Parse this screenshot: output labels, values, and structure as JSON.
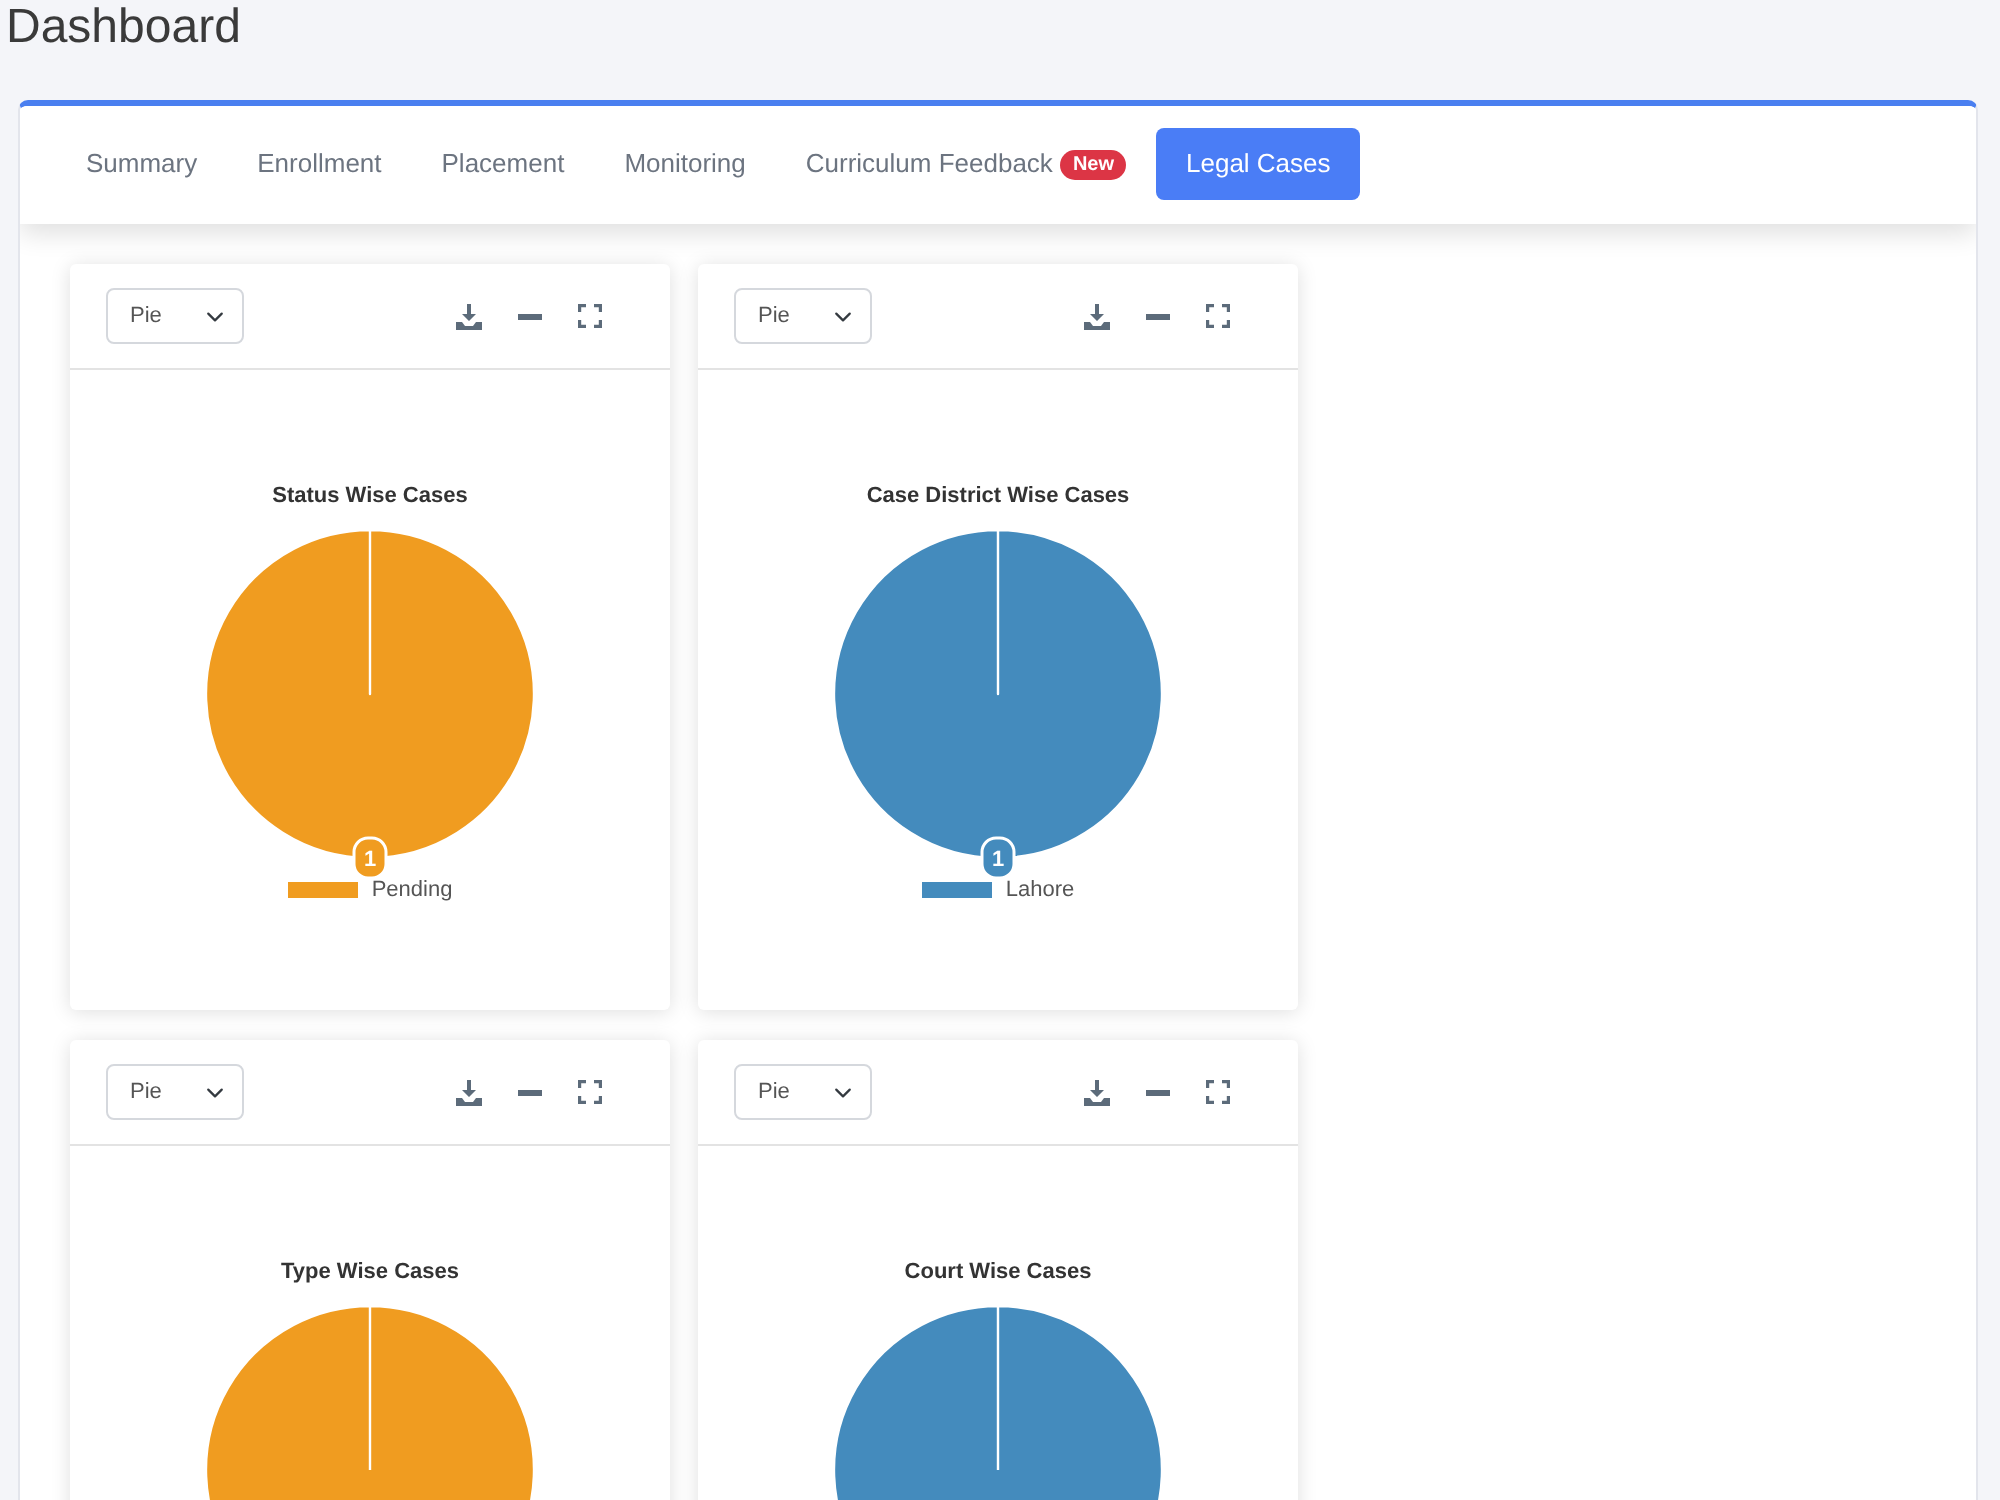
{
  "page": {
    "title": "Dashboard"
  },
  "tabs": [
    {
      "label": "Summary",
      "selected": false
    },
    {
      "label": "Enrollment",
      "selected": false
    },
    {
      "label": "Placement",
      "selected": false
    },
    {
      "label": "Monitoring",
      "selected": false
    },
    {
      "label": "Curriculum Feedback",
      "badge": "New",
      "selected": false
    },
    {
      "label": "Legal Cases",
      "selected": true
    }
  ],
  "charts": [
    {
      "chart_type": "Pie",
      "chart_data": {
        "type": "pie",
        "title": "Status Wise Cases",
        "categories": [
          "Pending"
        ],
        "series": [
          {
            "color": "#f09c20",
            "values": [
              1
            ]
          }
        ],
        "data_labels": true
      }
    },
    {
      "chart_type": "Pie",
      "chart_data": {
        "type": "pie",
        "title": "Case District Wise Cases",
        "categories": [
          "Lahore"
        ],
        "series": [
          {
            "color": "#448bbd",
            "values": [
              1
            ]
          }
        ],
        "data_labels": true
      }
    },
    {
      "chart_type": "Pie",
      "title": "Type Wise Cases",
      "color": "#f09c20"
    },
    {
      "chart_type": "Pie",
      "title": "Court Wise Cases",
      "color": "#448bbd"
    }
  ]
}
